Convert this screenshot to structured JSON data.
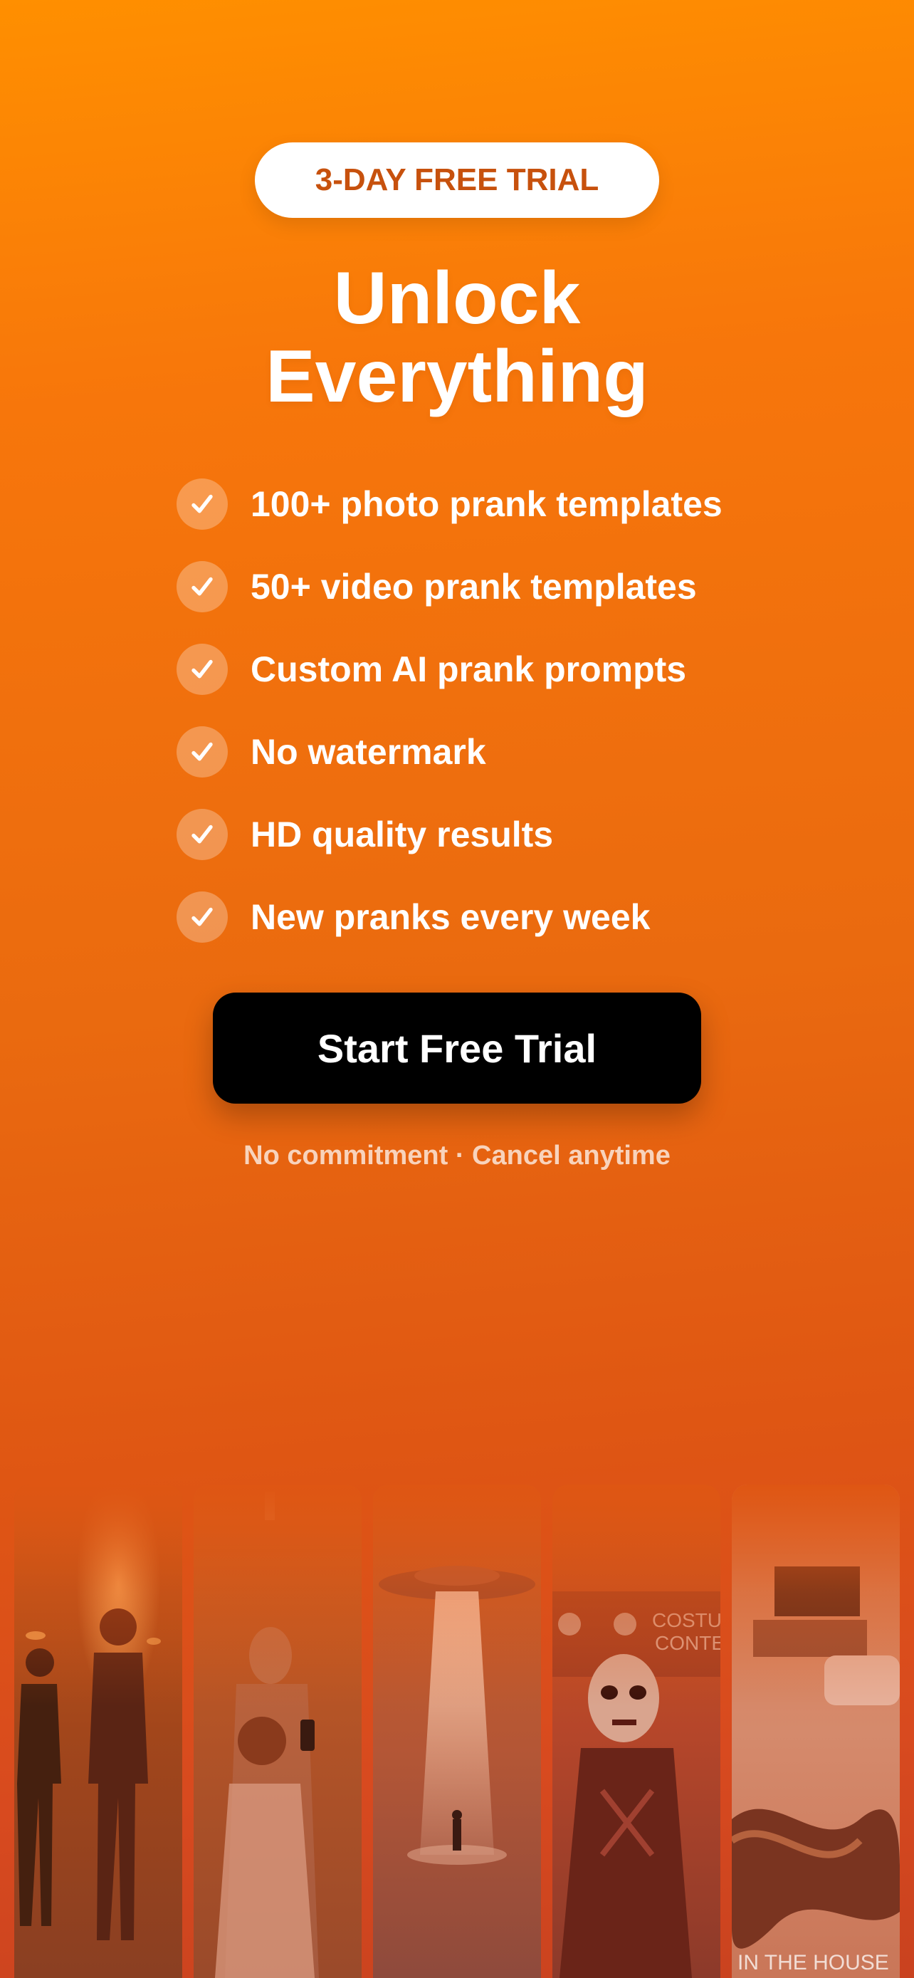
{
  "badge": {
    "label": "3-DAY FREE TRIAL"
  },
  "headline": {
    "line1": "Unlock",
    "line2": "Everything"
  },
  "features": [
    {
      "label": "100+ photo prank templates",
      "icon": "check-icon"
    },
    {
      "label": "50+ video prank templates",
      "icon": "check-icon"
    },
    {
      "label": "Custom AI prank prompts",
      "icon": "check-icon"
    },
    {
      "label": "No watermark",
      "icon": "check-icon"
    },
    {
      "label": "HD quality results",
      "icon": "check-icon"
    },
    {
      "label": "New pranks every week",
      "icon": "check-icon"
    }
  ],
  "cta": {
    "label": "Start Free Trial"
  },
  "subtext": "No commitment · Cancel anytime",
  "preview_tiles": [
    {
      "name": "night-street-photo"
    },
    {
      "name": "ghost-selfie-photo"
    },
    {
      "name": "ufo-abduction-photo"
    },
    {
      "name": "zombie-costume-photo"
    },
    {
      "name": "snake-in-house-photo",
      "caption": "IN THE HOUSE"
    }
  ],
  "colors": {
    "accent": "#ff8f00",
    "badge_text": "#c7510d",
    "cta_background": "#000000",
    "text": "#ffffff"
  }
}
